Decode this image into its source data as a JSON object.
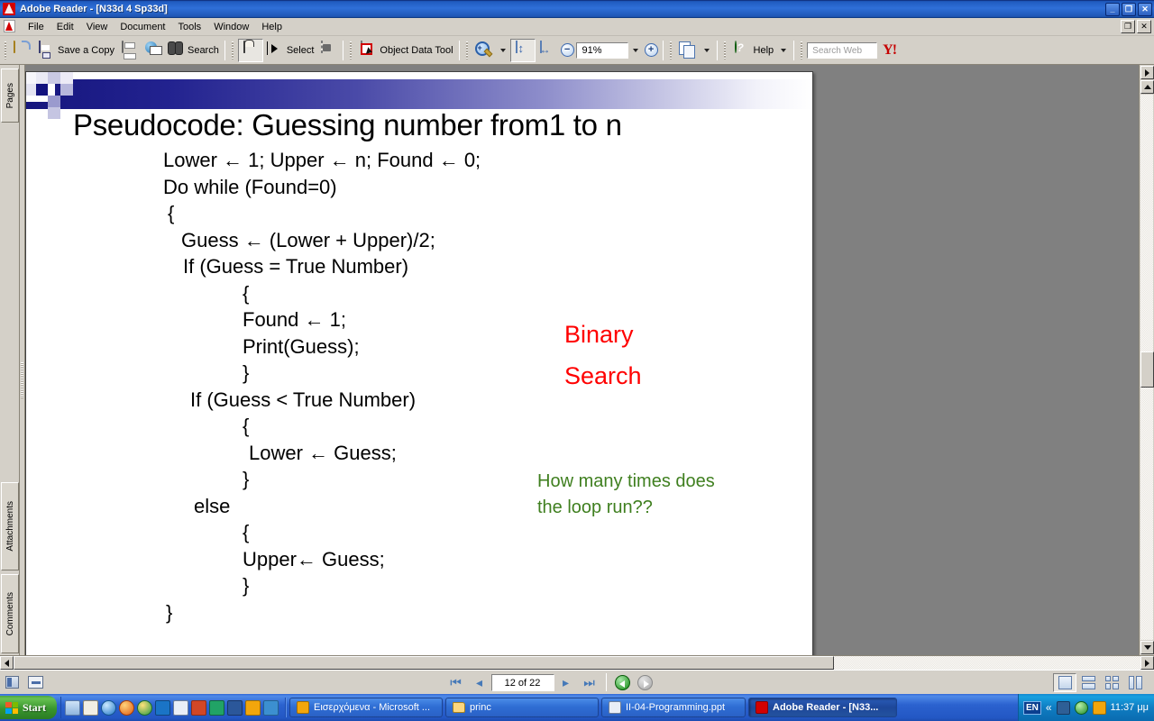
{
  "window": {
    "title": "Adobe Reader - [N33d 4 Sp33d]",
    "app_icon": "acrobat-icon",
    "minimize": "_",
    "restore": "❐",
    "close": "✕",
    "doc_restore": "❐",
    "doc_close": "✕"
  },
  "menu": {
    "items": [
      {
        "label": "File"
      },
      {
        "label": "Edit"
      },
      {
        "label": "View"
      },
      {
        "label": "Document"
      },
      {
        "label": "Tools"
      },
      {
        "label": "Window"
      },
      {
        "label": "Help"
      }
    ]
  },
  "toolbar": {
    "open_label": "",
    "save_label": "Save a Copy",
    "print_label": "",
    "email_label": "",
    "search_label": "Search",
    "hand_label": "",
    "select_label": "Select",
    "snapshot_label": "",
    "object_data_label": "Object Data Tool",
    "zoom_value": "91%",
    "help_label": "Help",
    "search_web_placeholder": "Search Web",
    "yahoo_label": "Y!"
  },
  "navpane": {
    "tabs": [
      {
        "label": "Pages"
      },
      {
        "label": "Attachments"
      },
      {
        "label": "Comments"
      }
    ]
  },
  "slide": {
    "title": "Pseudocode: Guessing number from1 to n",
    "code_lines": [
      {
        "text": "Lower ← 1; Upper ← n; Found ← 0;",
        "indent": 152
      },
      {
        "text": "Do while (Found=0)",
        "indent": 152
      },
      {
        "text": "{",
        "indent": 157
      },
      {
        "text": "Guess ← (Lower + Upper)/2;",
        "indent": 172
      },
      {
        "text": "If (Guess = True Number)",
        "indent": 174
      },
      {
        "text": "{",
        "indent": 240
      },
      {
        "text": "Found ← 1;",
        "indent": 240
      },
      {
        "text": "Print(Guess);",
        "indent": 240
      },
      {
        "text": "}",
        "indent": 240
      },
      {
        "text": "If (Guess < True Number)",
        "indent": 182
      },
      {
        "text": "{",
        "indent": 240
      },
      {
        "text": "Lower ← Guess;",
        "indent": 247
      },
      {
        "text": "}",
        "indent": 240
      },
      {
        "text": "else",
        "indent": 186
      },
      {
        "text": "{",
        "indent": 240
      },
      {
        "text": "Upper← Guess;",
        "indent": 240
      },
      {
        "text": "}",
        "indent": 240
      },
      {
        "text": "}",
        "indent": 155
      }
    ],
    "annotation_red": [
      "Binary",
      "Search"
    ],
    "annotation_green": [
      "How many times does",
      "the loop run??"
    ],
    "colors": {
      "red": "#ff0000",
      "green": "#3f7f1f",
      "band_dark": "#16167e"
    }
  },
  "statusbar": {
    "first_page_icon": "first-page-icon",
    "prev_page_icon": "prev-page-icon",
    "page_indicator": "12 of 22",
    "next_page_icon": "next-page-icon",
    "last_page_icon": "last-page-icon",
    "back_icon": "previous-view-icon",
    "forward_icon": "next-view-icon",
    "view_buttons": [
      "single-page",
      "continuous",
      "facing",
      "continuous-facing"
    ]
  },
  "taskbar": {
    "start_label": "Start",
    "quick_launch": [
      "show-desktop-icon",
      "notepad-icon",
      "internet-explorer-icon",
      "firefox-icon",
      "chrome-icon",
      "skype-icon",
      "word-doc-icon",
      "powerpoint-icon",
      "excel-icon",
      "word-icon",
      "clock-icon",
      "messenger-icon"
    ],
    "windows": [
      {
        "label": "Εισερχόμενα - Microsoft ...",
        "icon": "outlook-icon",
        "active": false
      },
      {
        "label": "princ",
        "icon": "folder-icon",
        "active": false
      },
      {
        "label": "II-04-Programming.ppt",
        "icon": "powerpoint-icon",
        "active": false
      },
      {
        "label": "Adobe Reader - [N33...",
        "icon": "acrobat-icon",
        "active": true
      }
    ],
    "tray": {
      "language": "EN",
      "chevron": "«",
      "icons": [
        "network-icon",
        "antivirus-icon",
        "clock-tray-icon"
      ],
      "clock": "11:37 μμ"
    }
  }
}
